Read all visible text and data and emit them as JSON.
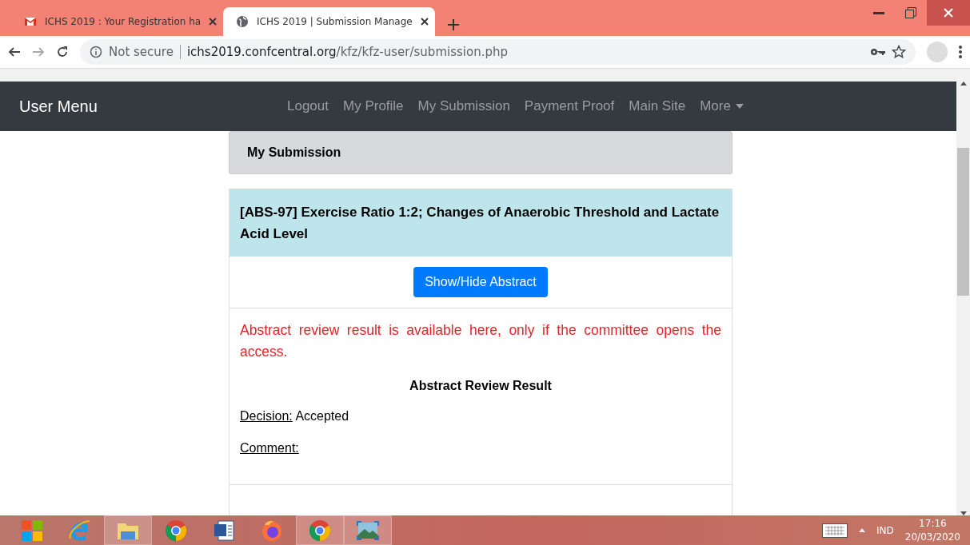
{
  "tabs": [
    {
      "title": "ICHS 2019 : Your Registration ha",
      "selected": false
    },
    {
      "title": "ICHS 2019 | Submission Manage",
      "selected": true
    }
  ],
  "address_bar": {
    "security": "Not secure",
    "host": "ichs2019.confcentral.org",
    "path": "/kfz/kfz-user/submission.php"
  },
  "navbar": {
    "brand": "User Menu",
    "links": [
      {
        "label": "Logout"
      },
      {
        "label": "My Profile"
      },
      {
        "label": "My Submission"
      },
      {
        "label": "Payment Proof"
      },
      {
        "label": "Main Site"
      },
      {
        "label": "More",
        "dropdown": true
      }
    ]
  },
  "page_header": "My Submission",
  "submission": {
    "title": "[ABS-97] Exercise Ratio 1:2; Changes of Anaerobic Threshold and Lactate Acid Level",
    "button": "Show/Hide Abstract",
    "notice": "Abstract review result is available here, only if the committee opens the access.",
    "result_heading": "Abstract Review Result",
    "fields": [
      {
        "label": "Decision:",
        "value": "Accepted"
      },
      {
        "label": "Comment:"
      }
    ]
  },
  "taskbar": {
    "apps": [
      {
        "kind": "windows",
        "highlighted": false
      },
      {
        "kind": "ie",
        "highlighted": false
      },
      {
        "kind": "folder",
        "highlighted": true
      },
      {
        "kind": "chrome",
        "highlighted": false
      },
      {
        "kind": "word",
        "highlighted": false
      },
      {
        "kind": "firefox",
        "highlighted": false
      },
      {
        "kind": "chrome",
        "highlighted": true
      },
      {
        "kind": "photos",
        "highlighted": true
      }
    ],
    "language": "IND",
    "time": "17:16",
    "date": "20/03/2020"
  }
}
